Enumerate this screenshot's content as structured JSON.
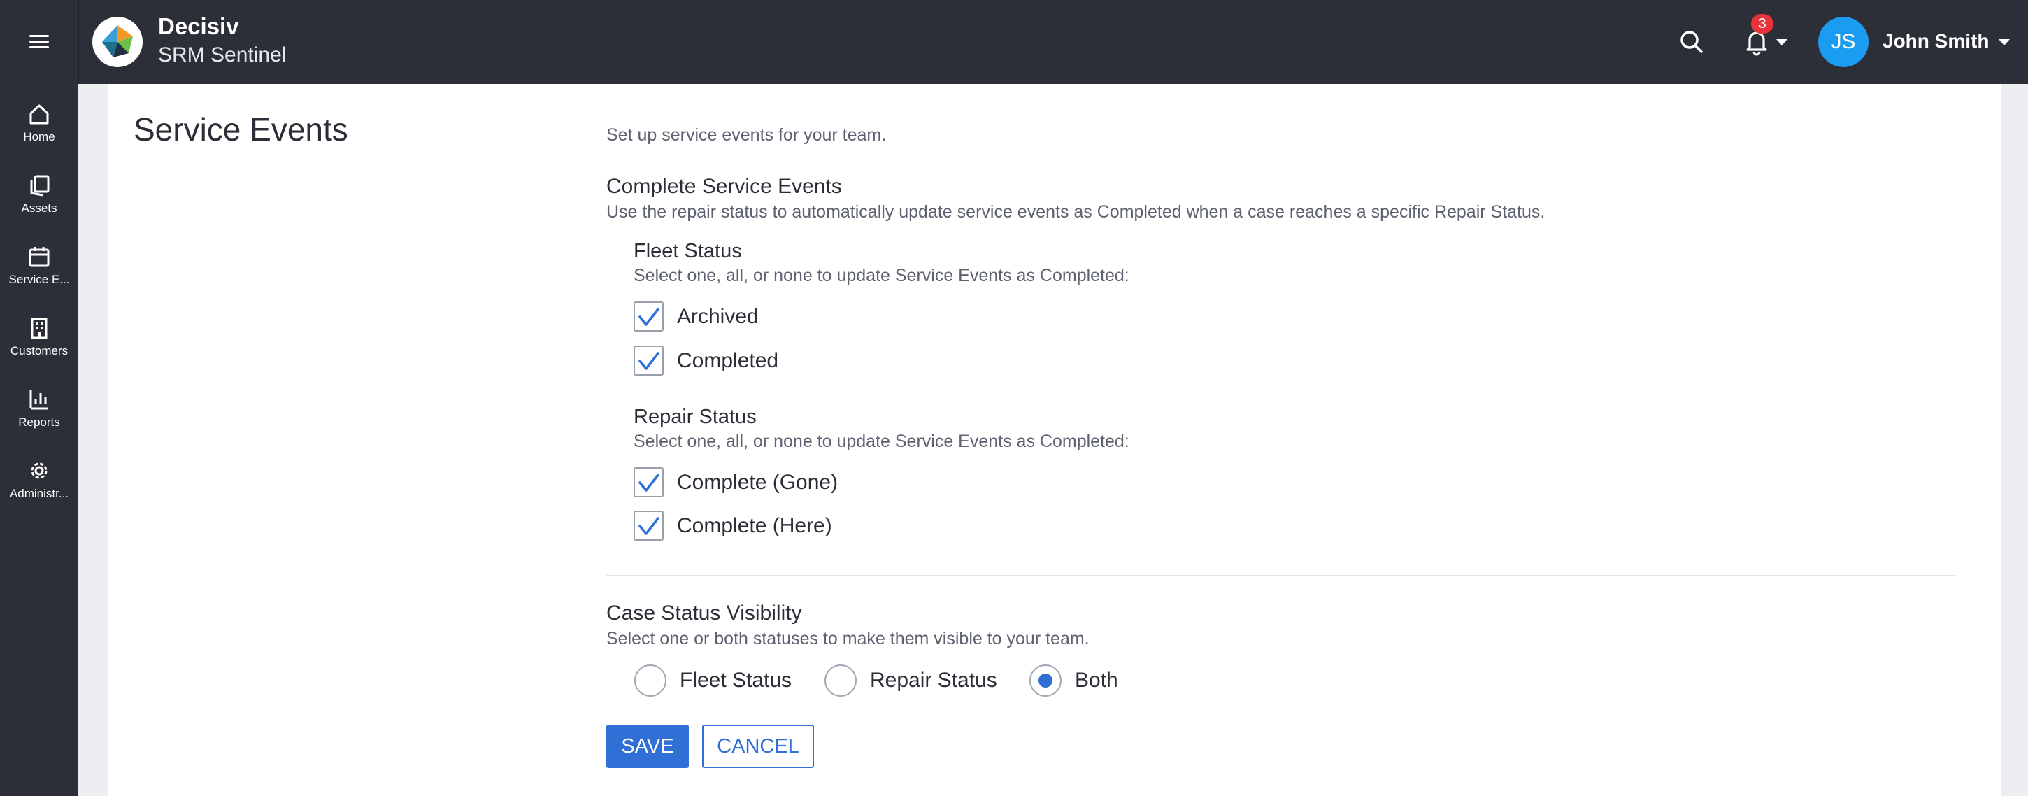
{
  "app": {
    "brand_name": "Decisiv",
    "brand_subtitle": "SRM Sentinel"
  },
  "header": {
    "notification_count": "3",
    "user": {
      "initials": "JS",
      "name": "John Smith"
    }
  },
  "sidebar": {
    "items": [
      {
        "label": "Home",
        "icon": "home-icon"
      },
      {
        "label": "Assets",
        "icon": "assets-icon"
      },
      {
        "label": "Service E...",
        "icon": "calendar-icon"
      },
      {
        "label": "Customers",
        "icon": "building-icon"
      },
      {
        "label": "Reports",
        "icon": "bar-chart-icon"
      },
      {
        "label": "Administr...",
        "icon": "gear-icon"
      }
    ]
  },
  "page": {
    "title": "Service Events",
    "intro": "Set up service events for your team."
  },
  "complete_section": {
    "title": "Complete Service Events",
    "description": "Use the repair status to automatically update service events as Completed when a case reaches a specific Repair Status.",
    "fleet": {
      "title": "Fleet Status",
      "description": "Select one, all, or none to update Service Events as Completed:",
      "options": [
        {
          "label": "Archived",
          "checked": true
        },
        {
          "label": "Completed",
          "checked": true
        }
      ]
    },
    "repair": {
      "title": "Repair Status",
      "description": "Select one, all, or none to update Service Events as Completed:",
      "options": [
        {
          "label": "Complete (Gone)",
          "checked": true
        },
        {
          "label": "Complete (Here)",
          "checked": true
        }
      ]
    }
  },
  "visibility_section": {
    "title": "Case Status Visibility",
    "description": "Select one or both statuses to make them visible to your team.",
    "options": [
      {
        "label": "Fleet Status",
        "selected": false
      },
      {
        "label": "Repair Status",
        "selected": false
      },
      {
        "label": "Both",
        "selected": true
      }
    ]
  },
  "actions": {
    "save_label": "SAVE",
    "cancel_label": "CANCEL"
  },
  "colors": {
    "accent": "#2f6fd6",
    "topbar": "#2c2f38",
    "avatar": "#1a9cf0",
    "badge": "#e8333a"
  }
}
